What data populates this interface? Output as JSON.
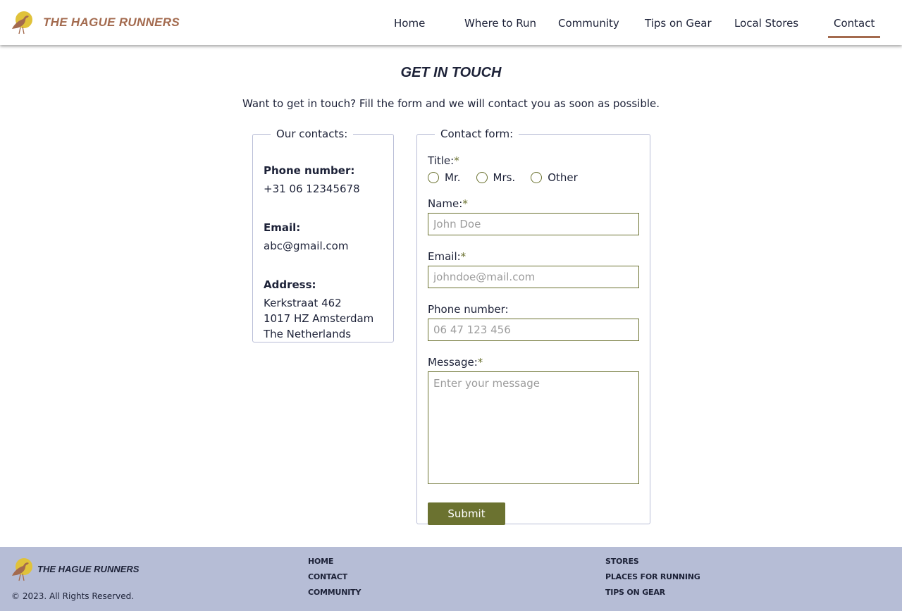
{
  "brand": {
    "name": "THE HAGUE RUNNERS"
  },
  "nav": [
    {
      "label": "Home"
    },
    {
      "label": "Where to Run"
    },
    {
      "label": "Community"
    },
    {
      "label": "Tips on Gear"
    },
    {
      "label": "Local Stores"
    },
    {
      "label": "Contact",
      "active": true
    }
  ],
  "page": {
    "title": "GET IN TOUCH",
    "intro": "Want to get in touch? Fill the form and we will contact you as soon as possible."
  },
  "contacts": {
    "legend": "Our contacts:",
    "phone_label": "Phone number:",
    "phone_value": "+31 06 12345678",
    "email_label": "Email:",
    "email_value": "abc@gmail.com",
    "address_label": "Address:",
    "address_lines": [
      "Kerkstraat 462",
      "1017 HZ Amsterdam",
      "The Netherlands"
    ]
  },
  "form": {
    "legend": "Contact form:",
    "required_mark": "*",
    "title_label": "Title:",
    "title_options": [
      "Mr.",
      "Mrs.",
      "Other"
    ],
    "name_label": "Name:",
    "name_placeholder": "John Doe",
    "email_label": "Email:",
    "email_placeholder": "johndoe@mail.com",
    "phone_label": "Phone number:",
    "phone_placeholder": "06 47 123 456",
    "message_label": "Message:",
    "message_placeholder": "Enter your message",
    "submit_label": "Submit"
  },
  "footer": {
    "brand": "THE HAGUE RUNNERS",
    "copyright": "© 2023. All Rights Reserved.",
    "col1": [
      "HOME",
      "CONTACT",
      "COMMUNITY"
    ],
    "col2": [
      "STORES",
      "PLACES FOR RUNNING",
      "TIPS ON GEAR"
    ]
  },
  "colors": {
    "brand": "#a36a4e",
    "accent": "#6b7230",
    "footer_bg": "#b6bdd6",
    "text": "#1d2238"
  },
  "icons": {
    "logo": "heron-sun-logo-icon"
  }
}
